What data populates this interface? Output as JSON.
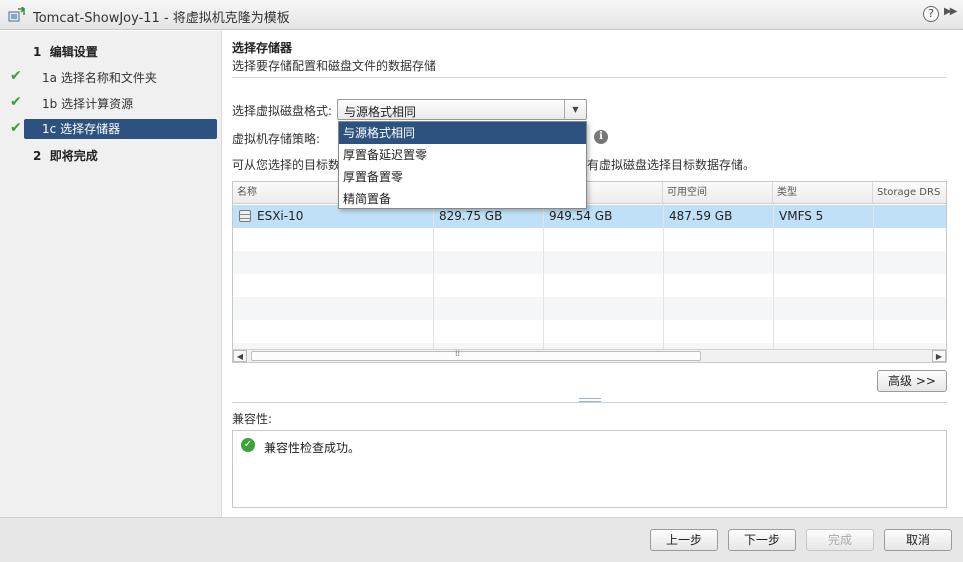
{
  "window": {
    "title": "Tomcat-ShowJoy-11 - 将虚拟机克隆为模板",
    "help": "?",
    "expand": "▶▶"
  },
  "nav": {
    "steps": [
      {
        "num": "1",
        "label": "编辑设置",
        "checked": false
      },
      {
        "num": "1a",
        "label": "选择名称和文件夹",
        "checked": true
      },
      {
        "num": "1b",
        "label": "选择计算资源",
        "checked": true
      },
      {
        "num": "1c",
        "label": "选择存储器",
        "checked": true,
        "active": true
      },
      {
        "num": "2",
        "label": "即将完成",
        "checked": false
      }
    ]
  },
  "header": {
    "title": "选择存储器",
    "desc": "选择要存储配置和磁盘文件的数据存储"
  },
  "form": {
    "disk_format_label": "选择虚拟磁盘格式:",
    "disk_format_value": "与源格式相同",
    "policy_label": "虚拟机存储策略:",
    "hint_prefix": "可从您选择的目标数",
    "hint_suffix": "所有虚拟磁盘选择目标数据存储。"
  },
  "dropdown": {
    "options": [
      "与源格式相同",
      "厚置备延迟置零",
      "厚置备置零",
      "精简置备"
    ],
    "selected_index": 0
  },
  "table": {
    "columns": [
      "名称",
      "",
      "",
      "可用空间",
      "类型",
      "Storage DRS"
    ],
    "rows": [
      {
        "name": "ESXi-10",
        "c1": "829.75 GB",
        "c2": "949.54 GB",
        "free": "487.59 GB",
        "type": "VMFS 5",
        "drs": ""
      }
    ],
    "advanced_button": "高级 >>"
  },
  "compat": {
    "label": "兼容性:",
    "message": "兼容性检查成功。"
  },
  "footer": {
    "back": "上一步",
    "next": "下一步",
    "finish": "完成",
    "cancel": "取消"
  },
  "colors": {
    "accent": "#2d5280",
    "selection": "#bfe0f6",
    "ok": "#3aa33a"
  }
}
